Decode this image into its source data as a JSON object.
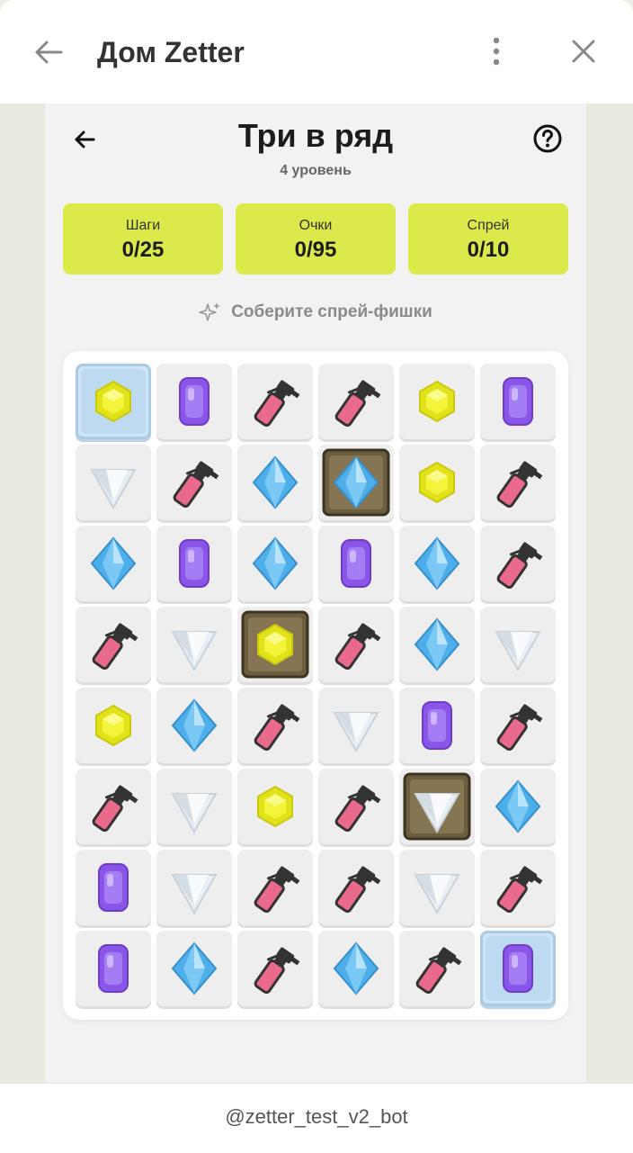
{
  "window": {
    "title": "Дом Zetter"
  },
  "game": {
    "title": "Три в ряд",
    "level": "4 уровень",
    "stats": [
      {
        "label": "Шаги",
        "value": "0/25"
      },
      {
        "label": "Очки",
        "value": "0/95"
      },
      {
        "label": "Спрей",
        "value": "0/10"
      }
    ],
    "hint": "Соберите спрей-фишки",
    "accent_color": "#dbea4a",
    "board": {
      "rows": 8,
      "cols": 6,
      "cells": [
        [
          "yellow-hex:frozen",
          "purple-gem",
          "spray-bottle",
          "spray-bottle",
          "yellow-hex",
          "purple-gem"
        ],
        [
          "white-diamond",
          "spray-bottle",
          "blue-diamond",
          "blue-diamond:stone",
          "yellow-hex",
          "spray-bottle"
        ],
        [
          "blue-diamond",
          "purple-gem",
          "blue-diamond",
          "purple-gem",
          "blue-diamond",
          "spray-bottle"
        ],
        [
          "spray-bottle",
          "white-diamond",
          "yellow-hex:stone",
          "spray-bottle",
          "blue-diamond",
          "white-diamond"
        ],
        [
          "yellow-hex",
          "blue-diamond",
          "spray-bottle",
          "white-diamond",
          "purple-gem",
          "spray-bottle"
        ],
        [
          "spray-bottle",
          "white-diamond",
          "yellow-hex",
          "spray-bottle",
          "white-diamond:stone",
          "blue-diamond"
        ],
        [
          "purple-gem",
          "white-diamond",
          "spray-bottle",
          "spray-bottle",
          "white-diamond",
          "spray-bottle"
        ],
        [
          "purple-gem",
          "blue-diamond",
          "spray-bottle",
          "blue-diamond",
          "spray-bottle",
          "purple-gem:frozen"
        ]
      ]
    }
  },
  "footer": {
    "bot_name": "@zetter_test_v2_bot"
  }
}
